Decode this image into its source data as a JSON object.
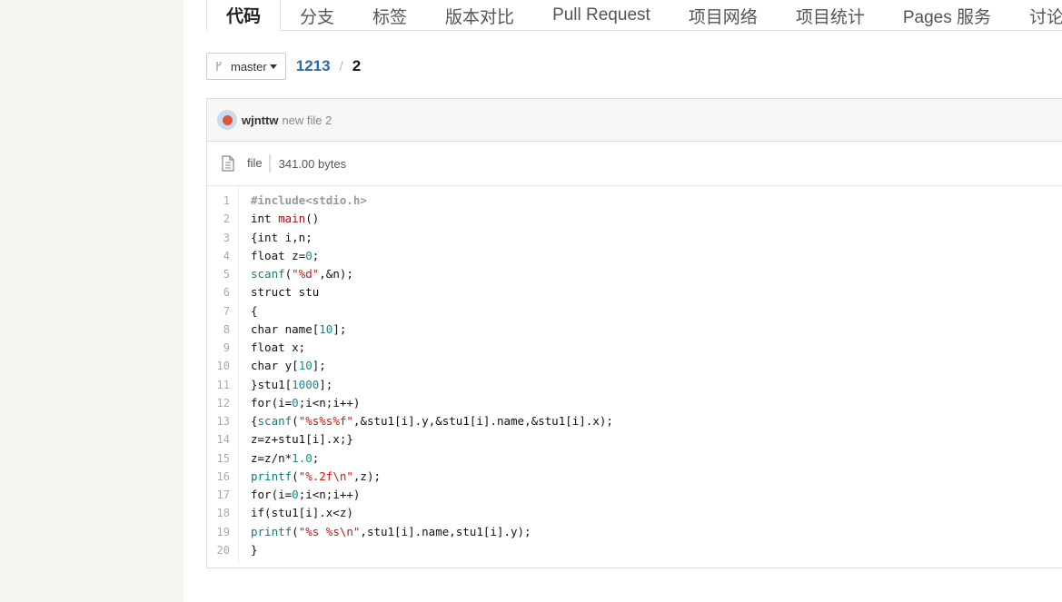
{
  "nav": {
    "tabs": [
      {
        "label": "代码",
        "active": true
      },
      {
        "label": "分支"
      },
      {
        "label": "标签"
      },
      {
        "label": "版本对比"
      },
      {
        "label": "Pull Request"
      },
      {
        "label": "项目网络"
      },
      {
        "label": "项目统计"
      },
      {
        "label": "Pages 服务"
      },
      {
        "label": "讨论"
      }
    ]
  },
  "toolbar": {
    "branch": "master",
    "breadcrumb": {
      "repo": "1213",
      "separator": "/",
      "file": "2"
    }
  },
  "commit": {
    "author": "wjnttw",
    "message": "new file 2"
  },
  "file_info": {
    "type": "file",
    "size": "341.00 bytes"
  },
  "code": {
    "lines": [
      "#include<stdio.h>",
      "int main()",
      "{int i,n;",
      "float z=0;",
      "scanf(\"%d\",&n);",
      "struct stu",
      "{",
      "char name[10];",
      "float x;",
      "char y[10];",
      "}stu1[1000];",
      "for(i=0;i<n;i++)",
      "{scanf(\"%s%s%f\",&stu1[i].y,&stu1[i].name,&stu1[i].x);",
      "z=z+stu1[i].x;}",
      "z=z/n*1.0;",
      "printf(\"%.2f\\n\",z);",
      "for(i=0;i<n;i++)",
      "if(stu1[i].x<z)",
      "printf(\"%s %s\\n\",stu1[i].name,stu1[i].y);",
      "}"
    ]
  },
  "colors": {
    "link": "#2a6aa5",
    "avatar_dot": "#e0533d",
    "string": "#c41a16",
    "number": "#1a8a8a"
  }
}
